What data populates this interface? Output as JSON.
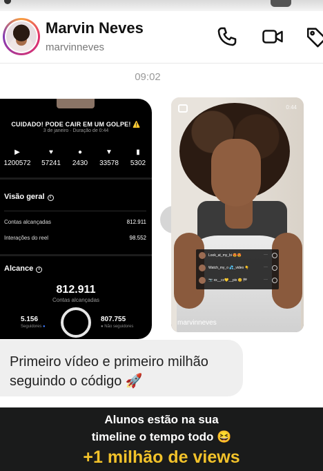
{
  "header": {
    "name": "Marvin Neves",
    "handle": "marvinneves",
    "call_icon": "phone-icon",
    "video_icon": "video-camera-icon",
    "tag_icon": "tag-icon"
  },
  "timestamp": "09:02",
  "insights_card": {
    "warning": "CUIDADO! PODE CAIR EM UM GOLPE! ⚠️",
    "meta": "3 de janeiro · Duração de 0:44",
    "stats": [
      {
        "icon": "play-icon",
        "glyph": "▶",
        "value": "1200572"
      },
      {
        "icon": "heart-icon",
        "glyph": "♥",
        "value": "57241"
      },
      {
        "icon": "comment-icon",
        "glyph": "●",
        "value": "2430"
      },
      {
        "icon": "share-icon",
        "glyph": "▼",
        "value": "33578"
      },
      {
        "icon": "save-icon",
        "glyph": "▮",
        "value": "5302"
      }
    ],
    "overview_title": "Visão geral",
    "overview_rows": [
      {
        "label": "Contas alcançadas",
        "value": "812.911"
      },
      {
        "label": "Interações do reel",
        "value": "98.552"
      }
    ],
    "reach_title": "Alcance",
    "reach_total": "812.911",
    "reach_label": "Contas alcançadas",
    "followers_value": "5.156",
    "followers_label": "Seguidores",
    "non_followers_value": "807.755",
    "non_followers_label": "Não seguidores"
  },
  "reel": {
    "owner": "marvinneves",
    "duration": "0:44",
    "comments": [
      {
        "text": "Look_at_my_bi 😍😍"
      },
      {
        "text": "Watch_my_o 💦_video 👇"
      },
      {
        "text": "📷 xx__cc💛__pix 😊 🏁"
      }
    ]
  },
  "message": {
    "text": "Primeiro vídeo e primeiro milhão seguindo o código 🚀"
  },
  "caption": {
    "line1": "Alunos estão na sua",
    "line2": "timeline o tempo todo 😆",
    "line3": "+1 milhão de views",
    "highlight_color": "#f2c22a"
  }
}
